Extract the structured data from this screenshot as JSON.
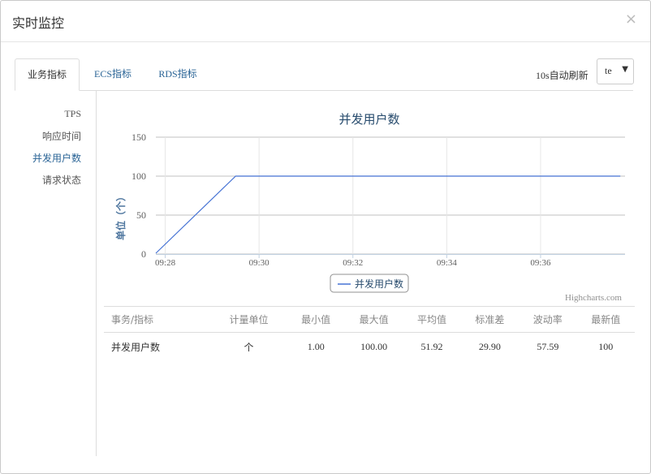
{
  "dialog": {
    "title": "实时监控",
    "close_icon": "close-icon",
    "close_glyph": "×"
  },
  "tabs": [
    {
      "label": "业务指标",
      "active": true
    },
    {
      "label": "ECS指标",
      "active": false
    },
    {
      "label": "RDS指标",
      "active": false
    }
  ],
  "refresh": {
    "label": "10s自动刷新",
    "select_value": "te",
    "arrow_glyph": "▼"
  },
  "side_nav": [
    {
      "label": "TPS",
      "active": false
    },
    {
      "label": "响应时间",
      "active": false
    },
    {
      "label": "并发用户数",
      "active": true
    },
    {
      "label": "请求状态",
      "active": false
    }
  ],
  "colors": {
    "accent": "#2a6496",
    "series": "#4572d4",
    "title": "#274b6d"
  },
  "chart_data": {
    "type": "line",
    "title": "并发用户数",
    "ylabel": "单位（个）",
    "xlabel": "",
    "ylim": [
      0,
      150
    ],
    "yticks": [
      0,
      50,
      100,
      150
    ],
    "x_tick_labels": [
      "09:28",
      "09:30",
      "09:32",
      "09:34",
      "09:36"
    ],
    "x_range": [
      "09:27.8",
      "09:37.8"
    ],
    "series": [
      {
        "name": "并发用户数",
        "points": [
          {
            "x": "09:27.8",
            "y": 1
          },
          {
            "x": "09:29.5",
            "y": 100
          },
          {
            "x": "09:37.7",
            "y": 100
          }
        ]
      }
    ],
    "grid": true,
    "legend": "bottom-center",
    "credit": "Highcharts.com"
  },
  "stats_table": {
    "headers": [
      "事务/指标",
      "计量单位",
      "最小值",
      "最大值",
      "平均值",
      "标准差",
      "波动率",
      "最新值"
    ],
    "rows": [
      [
        "并发用户数",
        "个",
        "1.00",
        "100.00",
        "51.92",
        "29.90",
        "57.59",
        "100"
      ]
    ]
  }
}
